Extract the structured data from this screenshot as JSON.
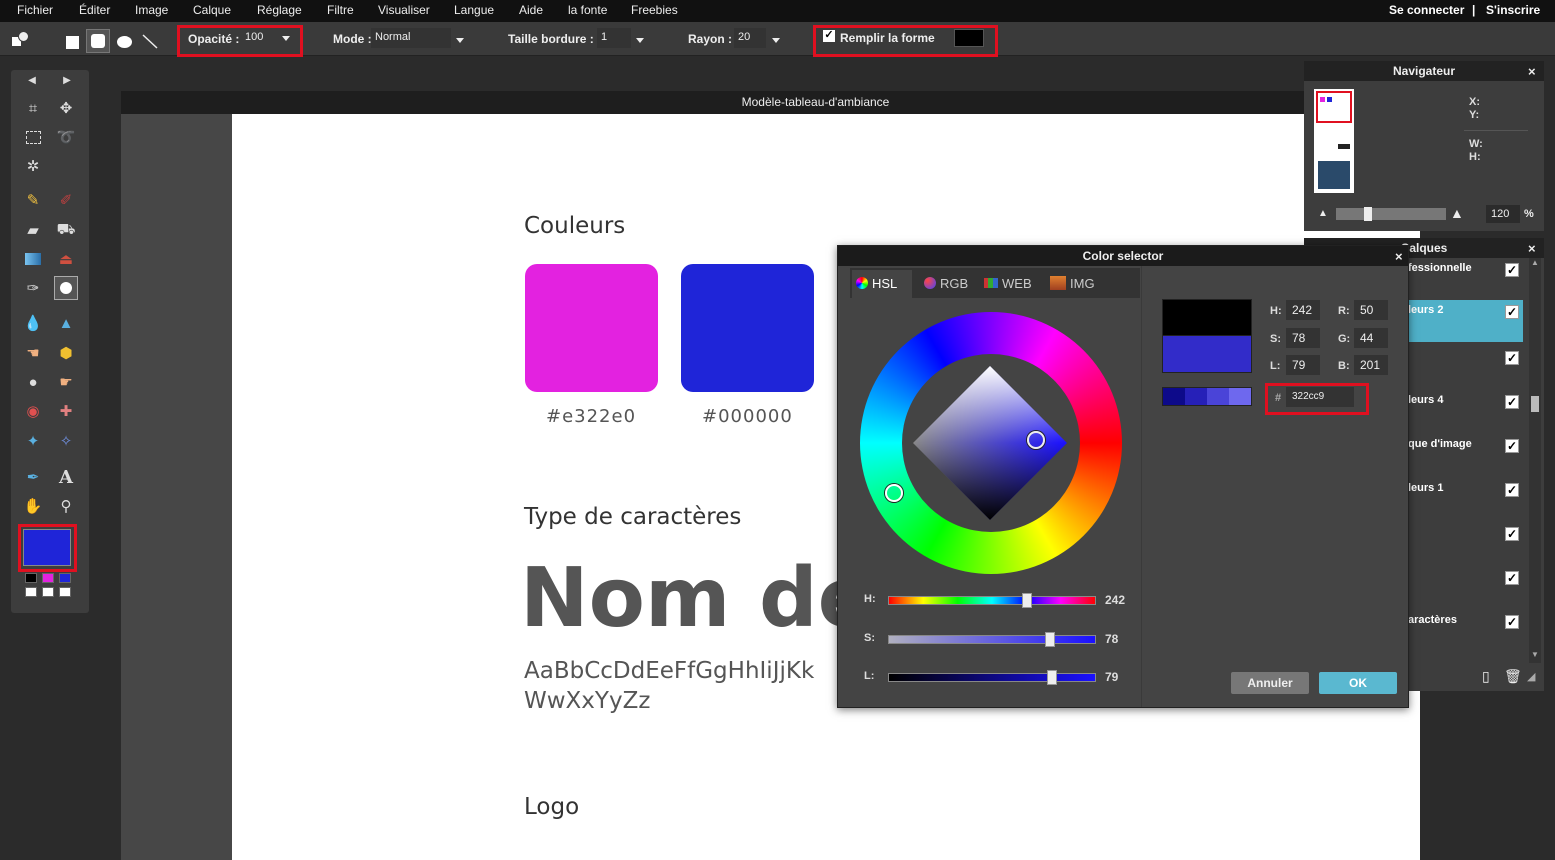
{
  "menu": {
    "items": [
      "Fichier",
      "Éditer",
      "Image",
      "Calque",
      "Réglage",
      "Filtre",
      "Visualiser",
      "Langue",
      "Aide",
      "la fonte",
      "Freebies"
    ],
    "login": "Se connecter",
    "separator": "|",
    "register": "S'inscrire"
  },
  "options": {
    "opacity_label": "Opacité :",
    "opacity_value": "100",
    "mode_label": "Mode :",
    "mode_value": "Normal",
    "border_label": "Taille bordure :",
    "border_value": "1",
    "radius_label": "Rayon :",
    "radius_value": "20",
    "fill_label": "Remplir la forme",
    "fill_checked": true,
    "fill_color": "#000000"
  },
  "tools": {
    "primary_color": "#1f25d8",
    "palette": [
      "#000000",
      "#e322e0",
      "#1f25d8",
      "#ffffff",
      "#ffffff",
      "#ffffff"
    ]
  },
  "document": {
    "title": "Modèle-tableau-d'ambiance",
    "section_colors": "Couleurs",
    "swatches": [
      {
        "color": "#e322e0",
        "label": "#e322e0"
      },
      {
        "color": "#1f25d8",
        "label": "#000000"
      }
    ],
    "section_type": "Type de caractères",
    "big_text": "Nom de",
    "alphabet_line1": "AaBbCcDdEeFfGgHhIiJjKk",
    "alphabet_line2": "WwXxYyZz",
    "section_logo": "Logo"
  },
  "color_selector": {
    "title": "Color selector",
    "close": "×",
    "tabs": [
      "HSL",
      "RGB",
      "WEB",
      "IMG"
    ],
    "active_tab": "HSL",
    "h": "242",
    "s": "78",
    "l": "79",
    "r": "50",
    "g": "44",
    "b": "201",
    "hex_prefix": "#",
    "hex": "322cc9",
    "labels": {
      "h": "H:",
      "s": "S:",
      "l": "L:",
      "r": "R:",
      "g": "G:",
      "b": "B:"
    },
    "old_color": "#000000",
    "new_color": "#322cc9",
    "shades": [
      "#0d0a8a",
      "#2620b8",
      "#4a44d8",
      "#6e68ee"
    ],
    "sliders": [
      {
        "label": "H:",
        "value": "242",
        "fraction": 0.67
      },
      {
        "label": "S:",
        "value": "78",
        "fraction": 0.78
      },
      {
        "label": "L:",
        "value": "79",
        "fraction": 0.79
      }
    ],
    "cancel": "Annuler",
    "ok": "OK"
  },
  "navigator": {
    "title": "Navigateur",
    "close": "×",
    "x_label": "X:",
    "y_label": "Y:",
    "w_label": "W:",
    "h_label": "H:",
    "zoom": "120",
    "zoom_unit": "%"
  },
  "layers": {
    "title": "Calques",
    "close": "×",
    "items": [
      {
        "label": "fessionnelle",
        "selected": false
      },
      {
        "label": "leurs 2",
        "selected": true
      },
      {
        "label": "",
        "selected": false
      },
      {
        "label": "leurs 4",
        "selected": false
      },
      {
        "label": "que d'image",
        "selected": false
      },
      {
        "label": "leurs 1",
        "selected": false
      },
      {
        "label": "",
        "selected": false
      },
      {
        "label": "",
        "selected": false
      },
      {
        "label": "aractères",
        "selected": false
      }
    ]
  }
}
